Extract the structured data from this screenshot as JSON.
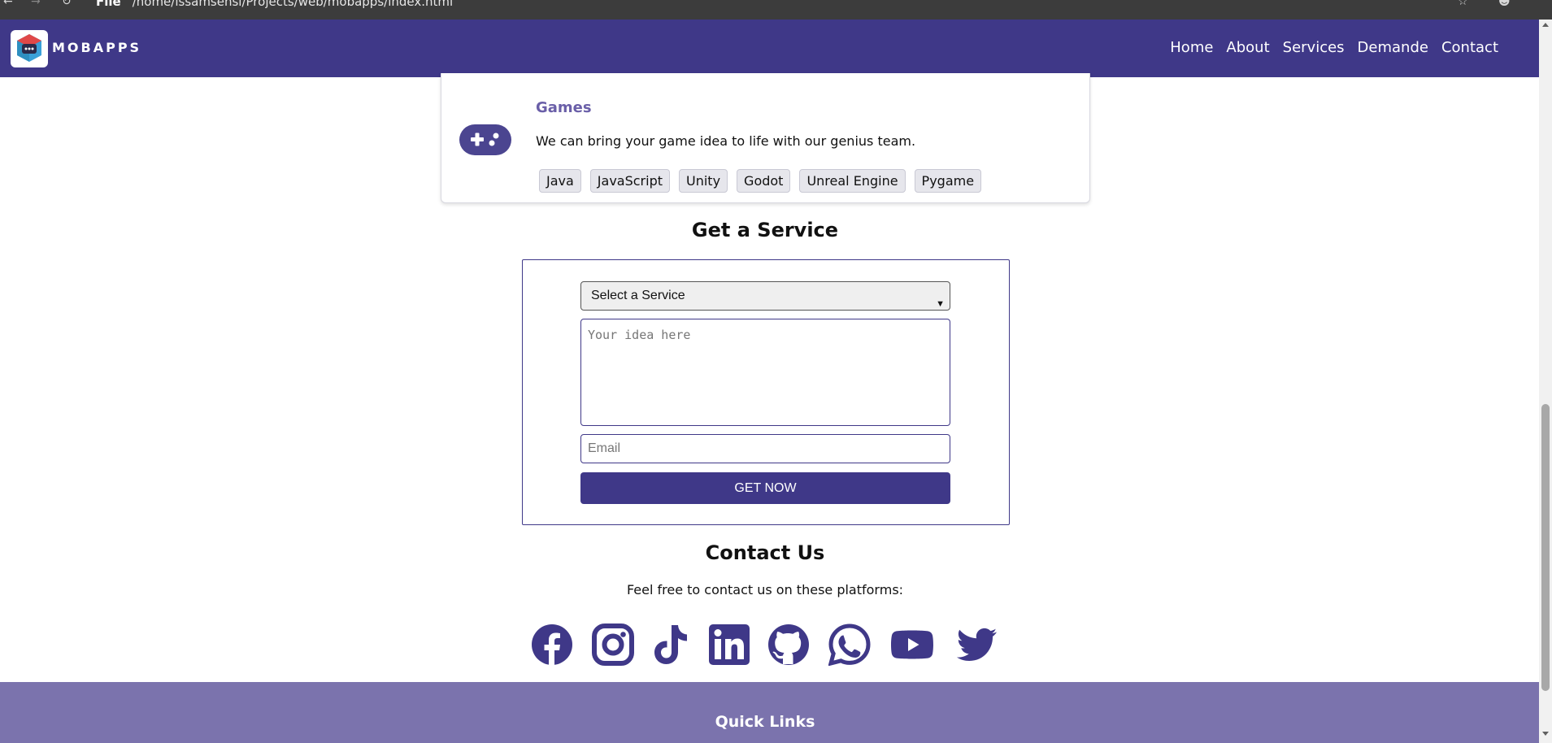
{
  "browser": {
    "file_label": "File",
    "url": "/home/issamsensi/Projects/web/mobapps/index.html"
  },
  "navbar": {
    "logo_text": "MOBAPPS",
    "links": [
      "Home",
      "About",
      "Services",
      "Demande",
      "Contact"
    ]
  },
  "games_card": {
    "title": "Games",
    "description": "We can bring your game idea to life with our genius team.",
    "tags": [
      "Java",
      "JavaScript",
      "Unity",
      "Godot",
      "Unreal Engine",
      "Pygame"
    ],
    "icon": "gamepad-icon"
  },
  "service_form": {
    "title": "Get a Service",
    "select_value": "Select a Service",
    "idea_placeholder": "Your idea here",
    "email_placeholder": "Email",
    "submit_label": "GET NOW"
  },
  "contact": {
    "title": "Contact Us",
    "text": "Feel free to contact us on these platforms:",
    "platforms": [
      "facebook-icon",
      "instagram-icon",
      "tiktok-icon",
      "linkedin-icon",
      "github-icon",
      "whatsapp-icon",
      "youtube-icon",
      "twitter-icon"
    ]
  },
  "footer": {
    "title": "Quick Links"
  },
  "colors": {
    "primary": "#3f3888",
    "footer": "#7b73ad",
    "card_title": "#6a5fa8"
  }
}
